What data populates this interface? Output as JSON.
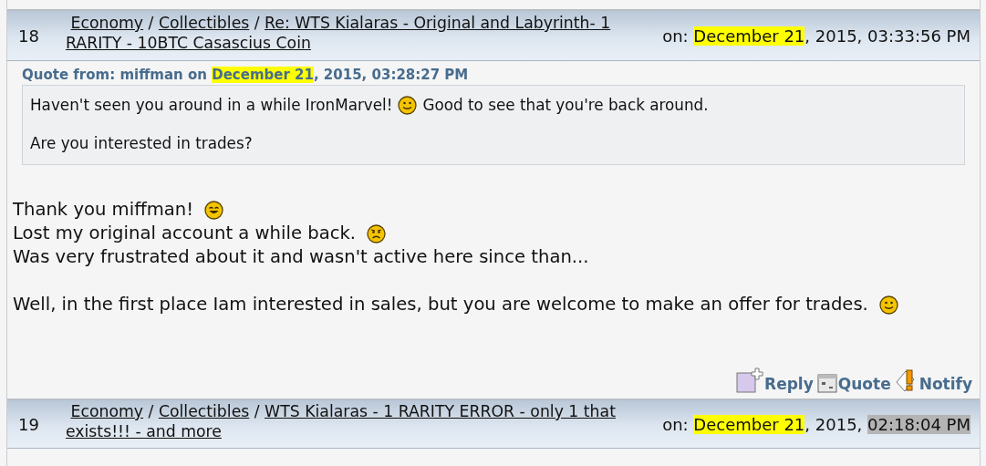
{
  "posts": [
    {
      "number": "18",
      "breadcrumb": {
        "separator": "/",
        "links": [
          "Economy",
          "Collectibles",
          "Re: WTS Kialaras - Original and Labyrinth- 1 RARITY - 10BTC Casascius Coin"
        ]
      },
      "date": {
        "label": "on:",
        "day": "December 21",
        "rest": ", 2015,",
        "time": "03:33:56 PM",
        "time_selected": false
      },
      "quote": {
        "header": {
          "label": "Quote from: miffman on",
          "day": "December 21",
          "rest": ", 2015, 03:28:27 PM"
        },
        "paragraphs": [
          [
            {
              "kind": "text",
              "text": "Haven't seen you around in a while IronMarvel!"
            },
            {
              "kind": "smile"
            },
            {
              "kind": "text",
              "text": "Good to see that you're back around."
            }
          ],
          [
            {
              "kind": "text",
              "text": "Are you interested in trades?"
            }
          ]
        ]
      },
      "body": [
        [
          [
            {
              "kind": "text",
              "text": "Thank you miffman!"
            },
            {
              "kind": "grin"
            }
          ],
          [
            {
              "kind": "text",
              "text": "Lost my original account a while back."
            },
            {
              "kind": "sad"
            }
          ],
          [
            {
              "kind": "text",
              "text": "Was very frustrated about it and wasn't active here since than..."
            }
          ]
        ],
        [
          [
            {
              "kind": "text",
              "text": "Well, in the first place Iam interested in sales, but you are welcome to make an offer for trades."
            },
            {
              "kind": "smile"
            }
          ]
        ]
      ],
      "actions": [
        {
          "kind": "reply",
          "label": "Reply"
        },
        {
          "kind": "quote",
          "label": "Quote"
        },
        {
          "kind": "notify",
          "label": "Notify"
        }
      ]
    },
    {
      "number": "19",
      "breadcrumb": {
        "separator": "/",
        "links": [
          "Economy",
          "Collectibles",
          "WTS Kialaras - 1 RARITY ERROR - only 1 that exists!!! - and more"
        ]
      },
      "date": {
        "label": "on:",
        "day": "December 21",
        "rest": ", 2015,",
        "time": "02:18:04 PM",
        "time_selected": true
      }
    }
  ]
}
